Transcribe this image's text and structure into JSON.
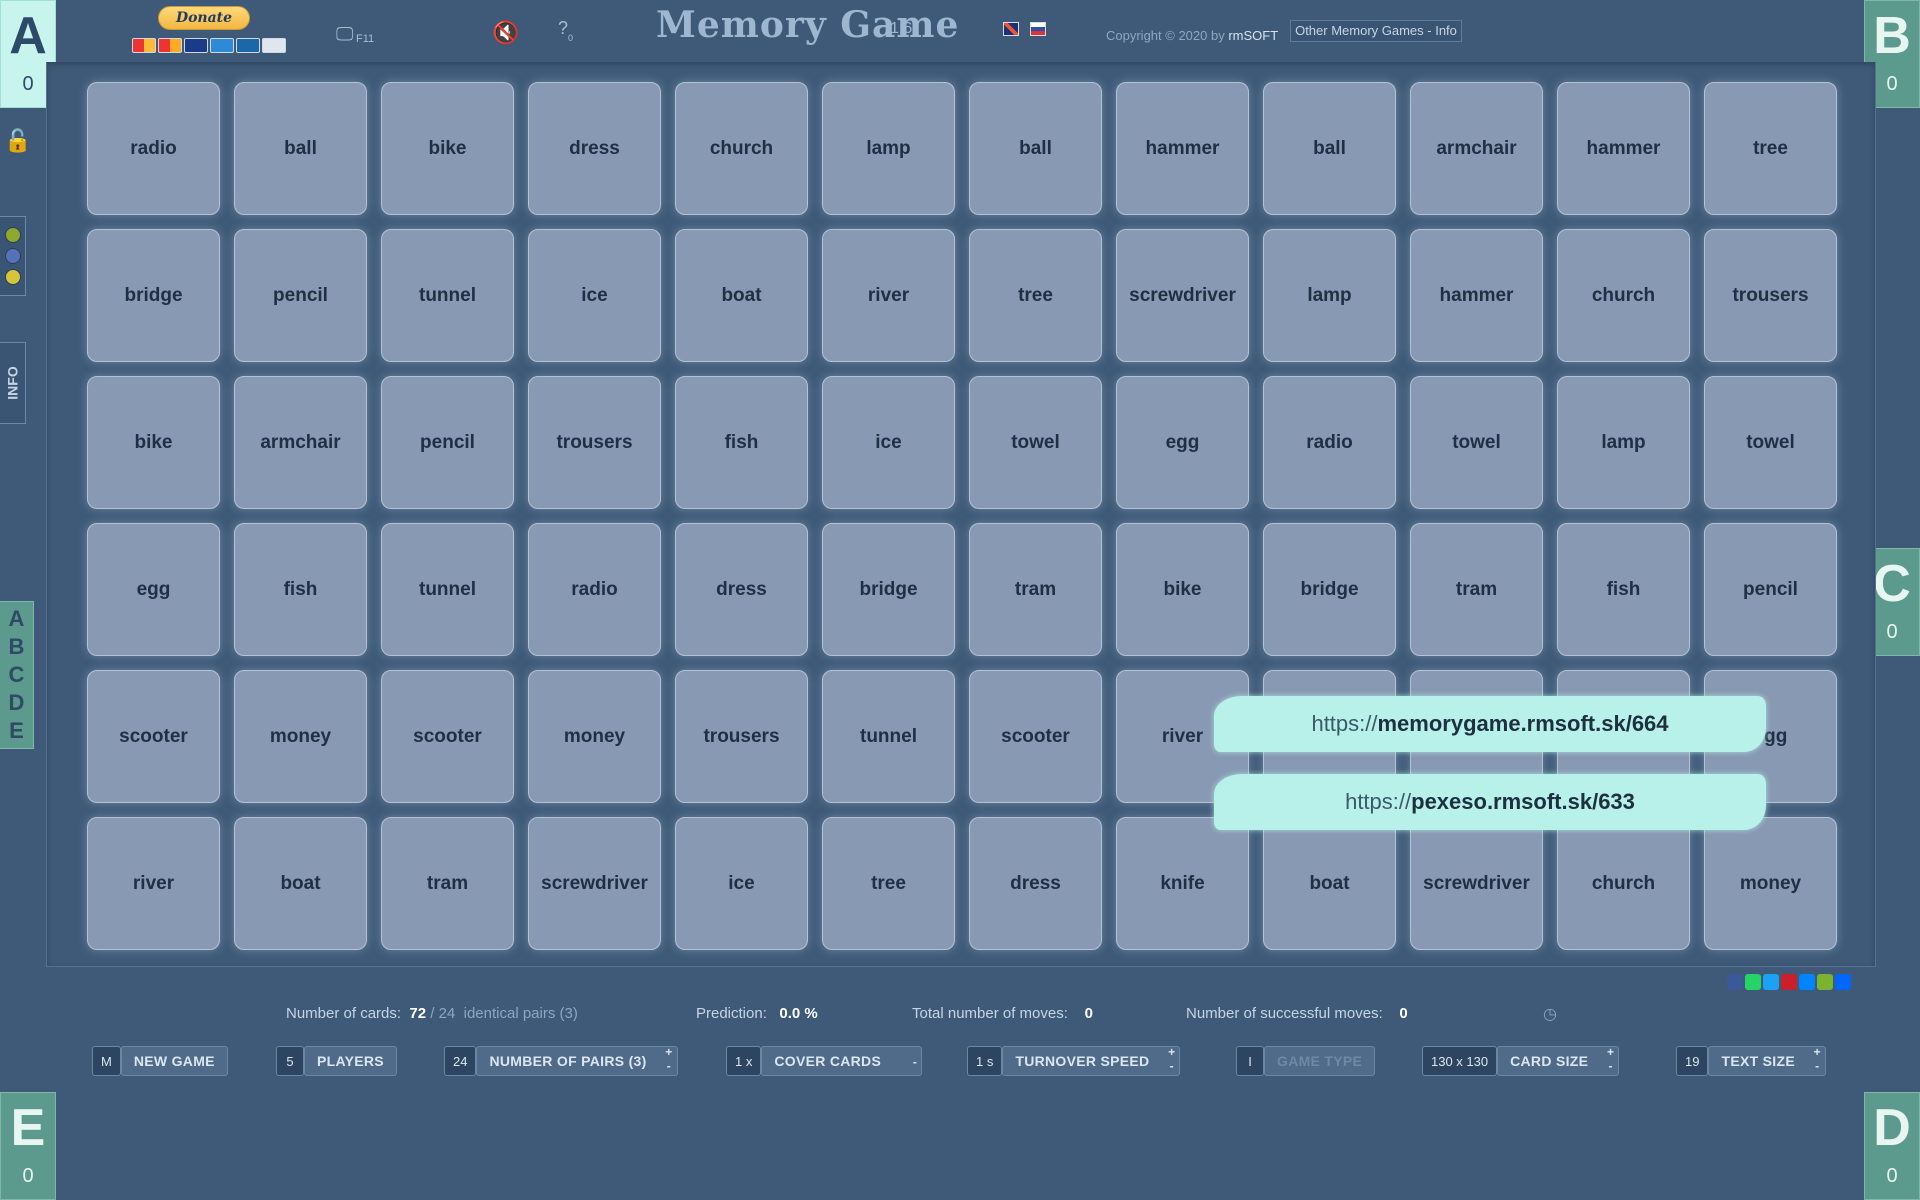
{
  "players": [
    {
      "letter": "A",
      "score": "0"
    },
    {
      "letter": "B",
      "score": "0"
    },
    {
      "letter": "C",
      "score": "0"
    },
    {
      "letter": "D",
      "score": "0"
    },
    {
      "letter": "E",
      "score": "0"
    }
  ],
  "header": {
    "donate_label": "Donate",
    "f11_label": "F11",
    "help_badge": "0",
    "title": "Memory Game",
    "version": "1.6",
    "copyright_prefix": "Copyright © 2020 by ",
    "copyright_brand": "rmSOFT",
    "other_games_label": "Other Memory Games - Info"
  },
  "sidebar": {
    "info_label": "INFO",
    "player_letters": [
      "A",
      "B",
      "C",
      "D",
      "E"
    ],
    "color_dots": [
      "#8fa82e",
      "#5872b8",
      "#d7c43a"
    ]
  },
  "board": {
    "cards": [
      "radio",
      "ball",
      "bike",
      "dress",
      "church",
      "lamp",
      "ball",
      "hammer",
      "ball",
      "armchair",
      "hammer",
      "tree",
      "bridge",
      "pencil",
      "tunnel",
      "ice",
      "boat",
      "river",
      "tree",
      "screwdriver",
      "lamp",
      "hammer",
      "church",
      "trousers",
      "bike",
      "armchair",
      "pencil",
      "trousers",
      "fish",
      "ice",
      "towel",
      "egg",
      "radio",
      "towel",
      "lamp",
      "towel",
      "egg",
      "fish",
      "tunnel",
      "radio",
      "dress",
      "bridge",
      "tram",
      "bike",
      "bridge",
      "tram",
      "fish",
      "pencil",
      "scooter",
      "money",
      "scooter",
      "money",
      "trousers",
      "tunnel",
      "scooter",
      "river",
      "",
      "",
      "",
      "egg",
      "river",
      "boat",
      "tram",
      "screwdriver",
      "ice",
      "tree",
      "dress",
      "knife",
      "boat",
      "screwdriver",
      "church",
      "money"
    ]
  },
  "overlay": {
    "url1_prefix": "https://",
    "url1_main": "memorygame.rmsoft.sk/664",
    "url2_prefix": "https://",
    "url2_main": "pexeso.rmsoft.sk/633"
  },
  "share_icons": [
    {
      "name": "facebook-icon",
      "color": "#3b5998"
    },
    {
      "name": "whatsapp-icon",
      "color": "#25d366"
    },
    {
      "name": "twitter-icon",
      "color": "#1da1f2"
    },
    {
      "name": "pinterest-icon",
      "color": "#cb2027"
    },
    {
      "name": "messenger-icon",
      "color": "#0084ff"
    },
    {
      "name": "wechat-icon",
      "color": "#7bb32e"
    },
    {
      "name": "share-more-icon",
      "color": "#0166ff"
    }
  ],
  "stats": {
    "cards_label": "Number of cards:",
    "cards_value": "72",
    "cards_sep": " / ",
    "pairs_value": "24",
    "pairs_label": "identical pairs (3)",
    "prediction_label": "Prediction:",
    "prediction_value": "0.0 %",
    "moves_label": "Total number of moves:",
    "moves_value": "0",
    "success_label": "Number of successful moves:",
    "success_value": "0"
  },
  "controls": {
    "newgame_key": "M",
    "newgame_label": "NEW GAME",
    "players_value": "5",
    "players_label": "PLAYERS",
    "pairs_value": "24",
    "pairs_label": "NUMBER OF PAIRS (3)",
    "cover_value": "1 x",
    "cover_label": "COVER CARDS",
    "speed_value": "1 s",
    "speed_label": "TURNOVER SPEED",
    "type_value": "I",
    "type_label": "GAME TYPE",
    "cardsize_value": "130 x 130",
    "cardsize_label": "CARD SIZE",
    "textsize_value": "19",
    "textsize_label": "TEXT SIZE"
  }
}
